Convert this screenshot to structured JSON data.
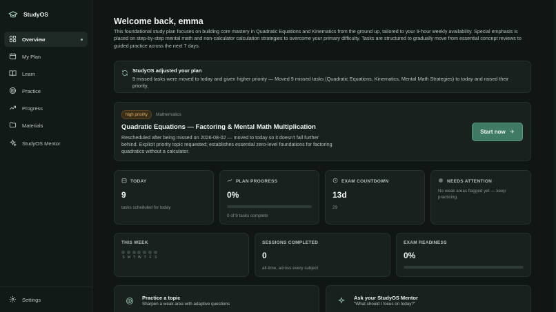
{
  "app": {
    "name": "StudyOS"
  },
  "sidebar": {
    "items": [
      {
        "label": "Overview",
        "icon": "grid-icon",
        "active": true
      },
      {
        "label": "My Plan",
        "icon": "calendar-icon"
      },
      {
        "label": "Learn",
        "icon": "book-icon"
      },
      {
        "label": "Practice",
        "icon": "target-icon"
      },
      {
        "label": "Progress",
        "icon": "trending-up-icon"
      },
      {
        "label": "Materials",
        "icon": "folder-icon"
      },
      {
        "label": "StudyOS Mentor",
        "icon": "sparkles-icon"
      }
    ],
    "settings_label": "Settings"
  },
  "header": {
    "title": "Welcome back, emma",
    "intro": "This foundational study plan focuses on building core mastery in Quadratic Equations and Kinematics from the ground up, tailored to your 9-hour weekly availability. Special emphasis is placed on step-by-step mental math and non-calculator calculation strategies to overcome your primary difficulty. Tasks are structured to gradually move from essential concept reviews to guided practice across the next 7 days."
  },
  "adjust": {
    "title": "StudyOS adjusted your plan",
    "body": "9 missed tasks were moved to today and given higher priority — Moved 9 missed tasks (Quadratic Equations, Kinematics, Mental Math Strategies) to today and raised their priority."
  },
  "task": {
    "priority": "high priority",
    "subject": "Mathematics",
    "title": "Quadratic Equations — Factoring & Mental Math Multiplication",
    "description": "Rescheduled after being missed on 2026-08-02 — moved to today so it doesn't fall further behind. Explicit priority topic requested; establishes essential zero-level foundations for factoring quadratics without a calculator.",
    "start_label": "Start now"
  },
  "stats": {
    "today": {
      "label": "TODAY",
      "value": "9",
      "note": "tasks scheduled for today"
    },
    "plan_progress": {
      "label": "PLAN PROGRESS",
      "value": "0%",
      "fraction": 0,
      "note": "0 of 9 tasks complete"
    },
    "exam_countdown": {
      "label": "EXAM COUNTDOWN",
      "value": "13d",
      "note": "29"
    },
    "needs_attention": {
      "label": "NEEDS ATTENTION",
      "note": "No weak areas flagged yet — keep practicing."
    },
    "this_week": {
      "label": "THIS WEEK",
      "days": [
        "S",
        "M",
        "T",
        "W",
        "T",
        "F",
        "S"
      ]
    },
    "sessions": {
      "label": "SESSIONS COMPLETED",
      "value": "0",
      "note": "all-time, across every subject"
    },
    "readiness": {
      "label": "EXAM READINESS",
      "value": "0%",
      "fraction": 0
    }
  },
  "actions": {
    "practice": {
      "title": "Practice a topic",
      "subtitle": "Sharpen a weak area with adaptive questions"
    },
    "mentor": {
      "title": "Ask your StudyOS Mentor",
      "subtitle": "\"What should I focus on today?\""
    }
  },
  "colors": {
    "accent": "#3f7a64",
    "priority_badge": "#e2b36a",
    "background": "#0f1613"
  }
}
